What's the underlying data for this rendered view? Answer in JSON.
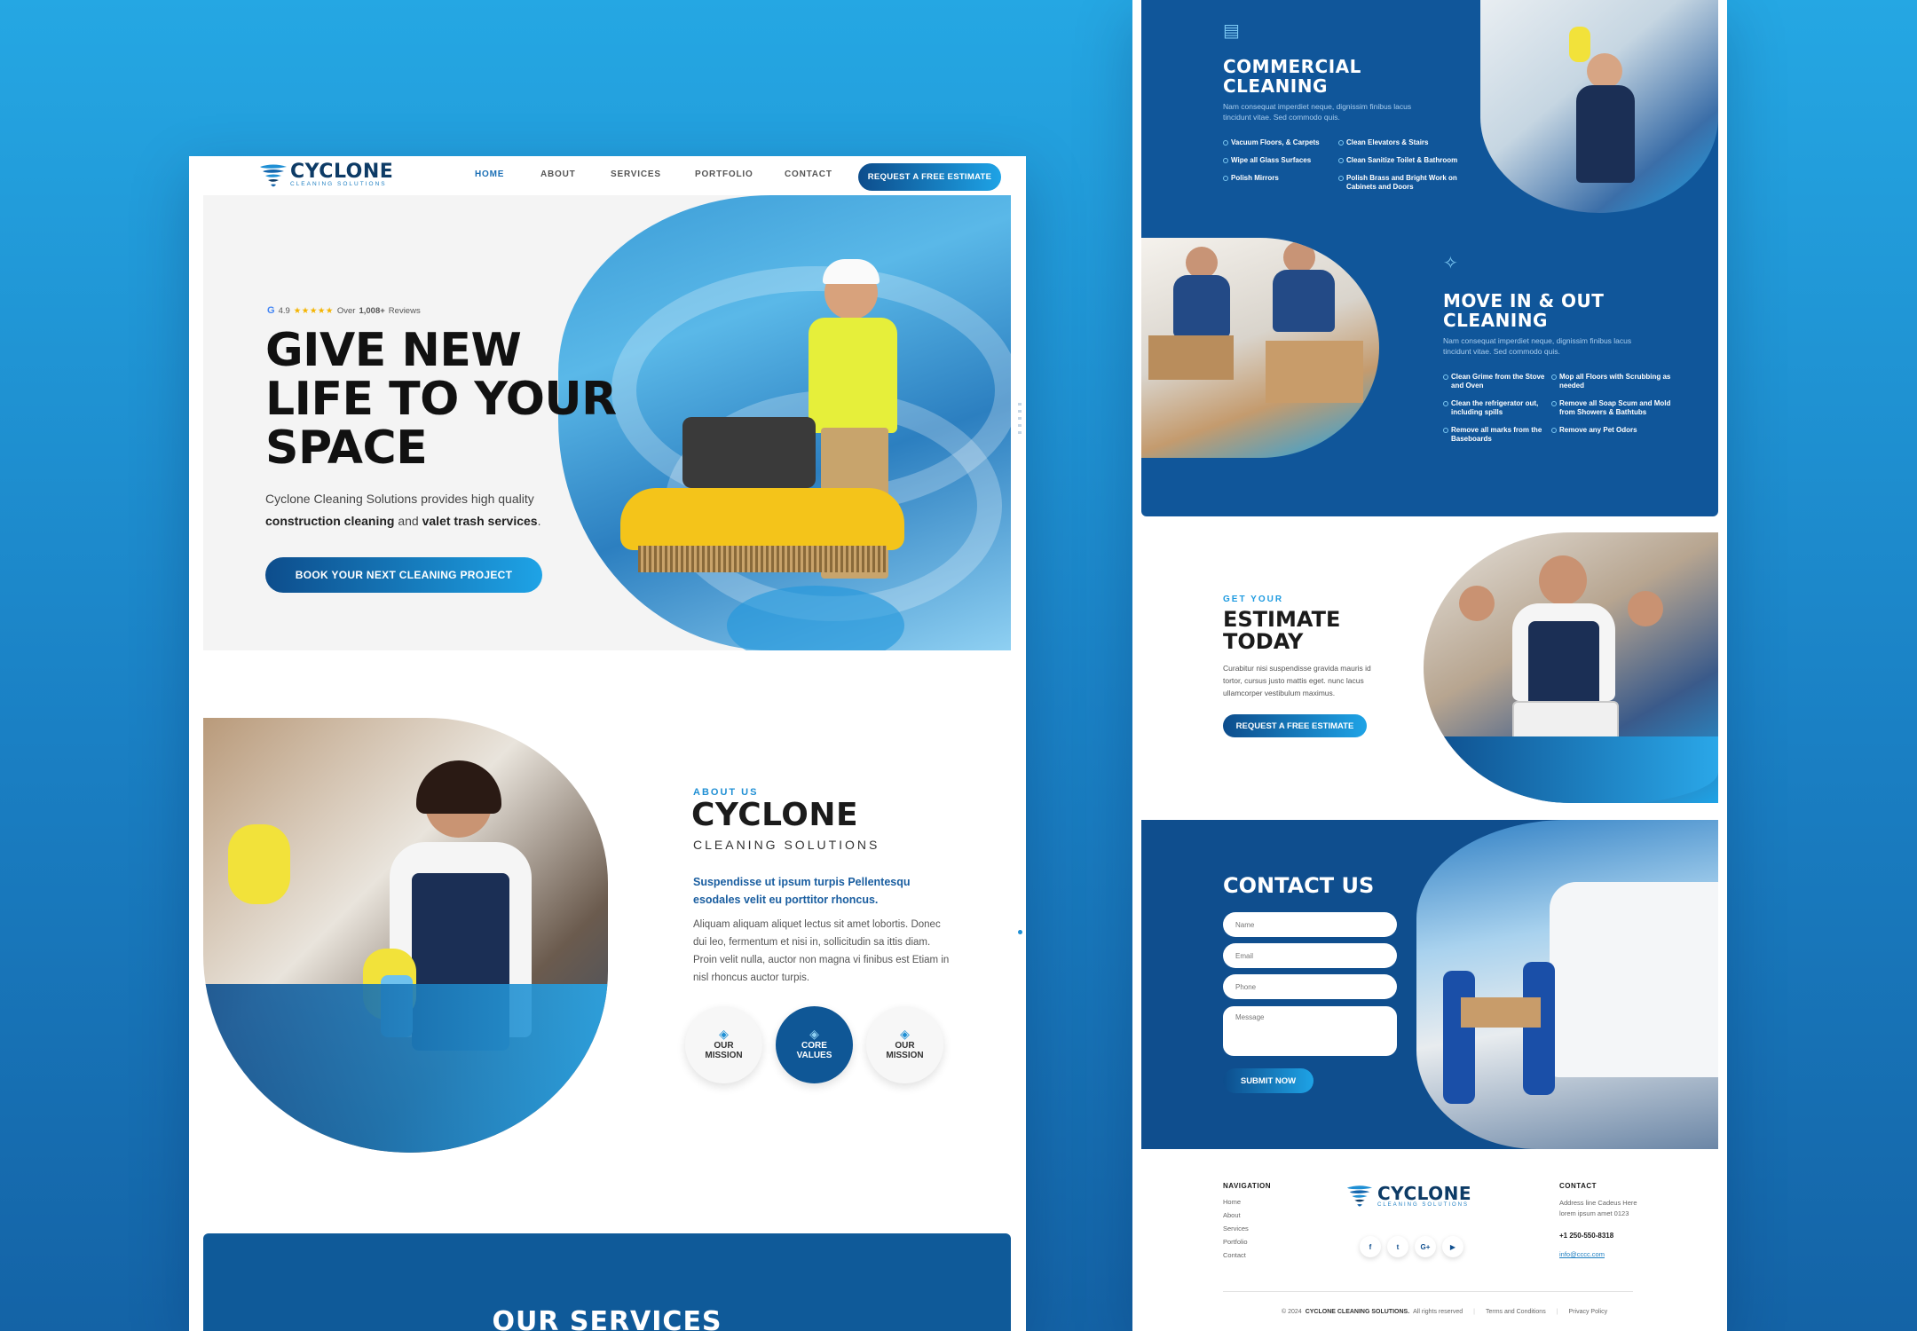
{
  "brand": {
    "name": "CYCLONE",
    "tagline": "CLEANING SOLUTIONS",
    "colors": {
      "primary_dark": "#0f5796",
      "primary_light": "#1ea3e6",
      "background": "#1a80c4"
    }
  },
  "left": {
    "nav": {
      "items": [
        "HOME",
        "ABOUT",
        "SERVICES",
        "PORTFOLIO",
        "CONTACT"
      ],
      "active": "HOME",
      "cta": "REQUEST A FREE ESTIMATE"
    },
    "hero": {
      "rating_value": "4.9",
      "rating_stars": "★★★★★",
      "rating_prefix": "Over",
      "rating_count": "1,008+",
      "rating_suffix": "Reviews",
      "title_line1": "GIVE NEW",
      "title_line2": "LIFE TO YOUR",
      "title_line3": "SPACE",
      "desc_start": "Cyclone Cleaning Solutions provides high quality",
      "desc_bold1": "construction cleaning",
      "desc_and": "and",
      "desc_bold2": "valet trash services",
      "desc_end": ".",
      "button": "BOOK YOUR NEXT CLEANING PROJECT"
    },
    "about": {
      "kicker": "ABOUT US",
      "title": "CYCLONE",
      "subtitle": "CLEANING SOLUTIONS",
      "lead": "Suspendisse ut ipsum turpis Pellentesqu esodales velit eu porttitor rhoncus.",
      "body": "Aliquam aliquam aliquet lectus sit amet lobortis. Donec dui leo, fermentum et nisi in, sollicitudin sa ittis diam. Proin velit nulla, auctor non magna vi finibus est Etiam in nisl rhoncus auctor turpis.",
      "badges": [
        {
          "line1": "OUR",
          "line2": "MISSION"
        },
        {
          "line1": "CORE",
          "line2": "VALUES"
        },
        {
          "line1": "OUR",
          "line2": "MISSION"
        }
      ]
    },
    "services": {
      "title": "OUR SERVICES"
    }
  },
  "right": {
    "commercial": {
      "title_line1": "COMMERCIAL",
      "title_line2": "CLEANING",
      "desc": "Nam consequat imperdiet neque, dignissim finibus lacus tincidunt vitae. Sed commodo quis.",
      "col1": [
        "Vacuum Floors, & Carpets",
        "Wipe all Glass Surfaces",
        "Polish Mirrors"
      ],
      "col2": [
        "Clean Elevators & Stairs",
        "Clean Sanitize Toilet & Bathroom",
        "Polish Brass and Bright Work on Cabinets and Doors"
      ]
    },
    "movein": {
      "title_line1": "MOVE IN & OUT",
      "title_line2": "CLEANING",
      "desc": "Nam consequat imperdiet neque, dignissim finibus lacus tincidunt vitae. Sed commodo quis.",
      "col1": [
        "Clean Grime from the Stove and Oven",
        "Clean the refrigerator out, including spills",
        "Remove all marks from the Baseboards"
      ],
      "col2": [
        "Mop all Floors with Scrubbing as needed",
        "Remove all Soap Scum and Mold from Showers & Bathtubs",
        "Remove any Pet Odors"
      ]
    },
    "estimate": {
      "kicker": "GET YOUR",
      "title_line1": "ESTIMATE",
      "title_line2": "TODAY",
      "body": "Curabitur nisi suspendisse gravida mauris id tortor, cursus justo mattis eget. nunc lacus ullamcorper vestibulum maximus.",
      "button": "REQUEST A FREE ESTIMATE"
    },
    "contact": {
      "title": "CONTACT US",
      "name_ph": "Name",
      "email_ph": "Email",
      "phone_ph": "Phone",
      "message_ph": "Message",
      "submit": "SUBMIT NOW"
    },
    "footer": {
      "nav_head": "NAVIGATION",
      "nav_items": [
        "Home",
        "About",
        "Services",
        "Portfolio",
        "Contact"
      ],
      "contact_head": "CONTACT",
      "address_line1": "Address line Cadeus Here",
      "address_line2": "lorem ipsum amet 0123",
      "phone": "+1 250-550-8318",
      "email": "info@cccc.com",
      "social": [
        "f",
        "t",
        "G+",
        "▶"
      ],
      "copyright_prefix": "© 2024",
      "copyright_brand": "CYCLONE CLEANING SOLUTIONS.",
      "copyright_suffix": "All rights reserved",
      "terms": "Terms and Conditions",
      "privacy": "Privacy Policy"
    }
  }
}
